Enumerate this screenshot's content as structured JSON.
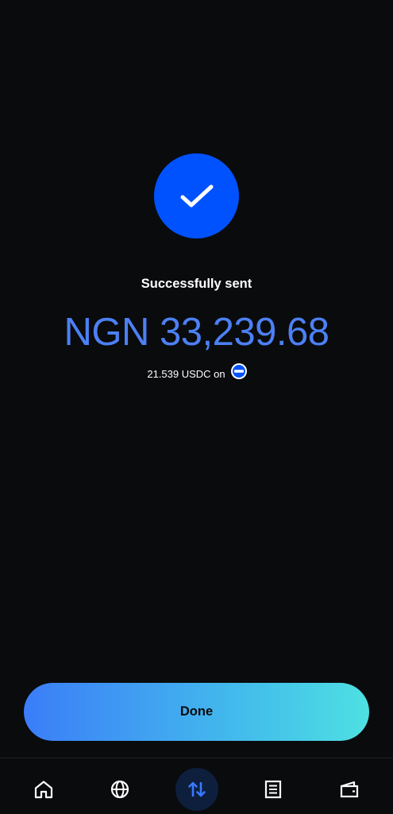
{
  "status": {
    "title": "Successfully sent",
    "icon": "checkmark-icon"
  },
  "transaction": {
    "amount": "NGN 33,239.68",
    "crypto_amount": "21.539 USDC on",
    "network_icon": "base-network-icon"
  },
  "actions": {
    "done_label": "Done"
  },
  "bottom_nav": {
    "items": [
      {
        "icon": "home-icon",
        "active": false
      },
      {
        "icon": "globe-icon",
        "active": false
      },
      {
        "icon": "transfer-arrows-icon",
        "active": true
      },
      {
        "icon": "document-list-icon",
        "active": false
      },
      {
        "icon": "wallet-icon",
        "active": false
      }
    ]
  },
  "colors": {
    "background": "#0a0b0d",
    "accent": "#0052ff",
    "amount_text": "#4c80f5",
    "button_gradient_start": "#3b7df8",
    "button_gradient_end": "#4ee0e2"
  }
}
